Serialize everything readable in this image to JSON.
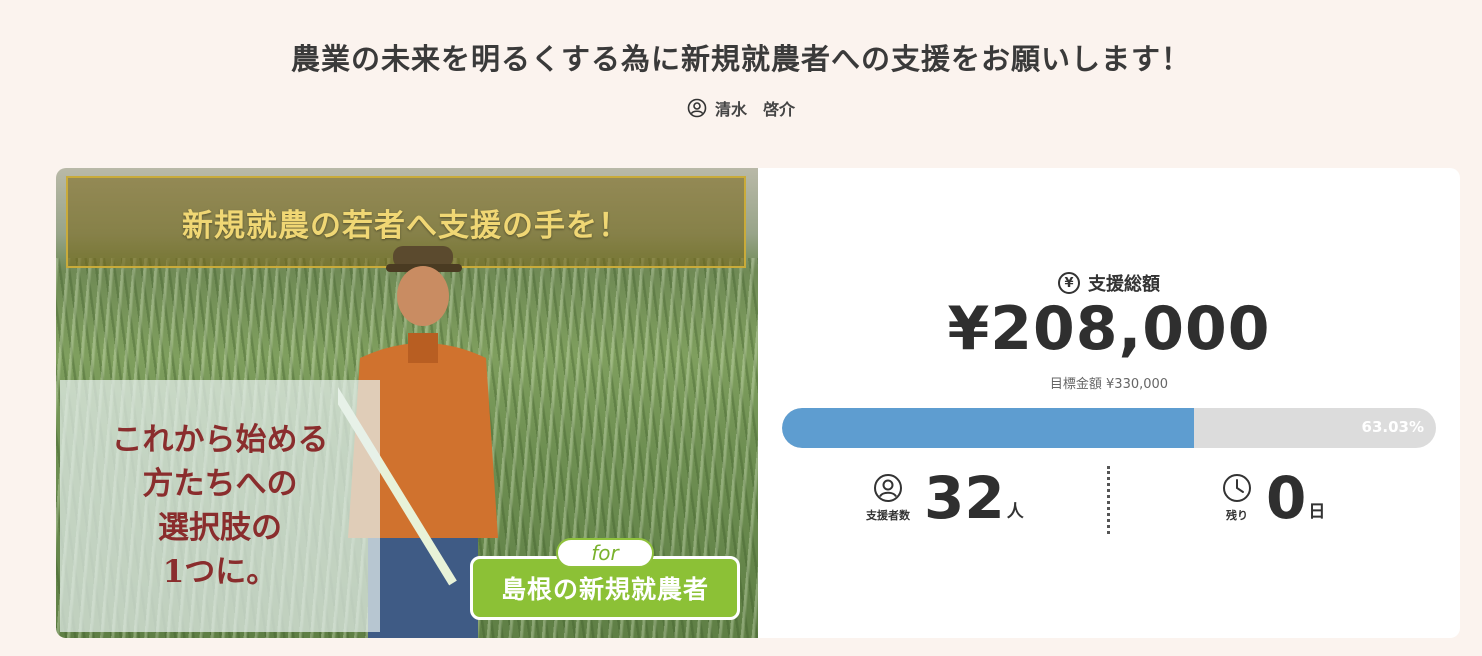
{
  "project": {
    "title": "農業の未来を明るくする為に新規就農者への支援をお願いします！",
    "owner_name": "清水　啓介"
  },
  "hero": {
    "banner_text": "新規就農の若者へ支援の手を！",
    "quote_text": "これから始める\n方たちへの\n選択肢の\n1つに。",
    "for_label": "for",
    "region_label": "島根の新規就農者"
  },
  "funding": {
    "total_label": "支援総額",
    "yen_icon": "¥",
    "total_value": "¥208,000",
    "goal_text": "目標金額 ¥330,000",
    "progress_fraction": 0.6303,
    "progress_text": "63.03%",
    "colors": {
      "fill": "#5e9dd0",
      "track": "#dcdcdc"
    }
  },
  "stats": {
    "supporters_caption": "支援者数",
    "supporters_value": "32",
    "supporters_unit": "人",
    "remaining_caption": "残り",
    "remaining_value": "0",
    "remaining_unit": "日"
  },
  "icons": [
    "user-icon",
    "yen-icon",
    "supporters-icon",
    "clock-icon"
  ]
}
